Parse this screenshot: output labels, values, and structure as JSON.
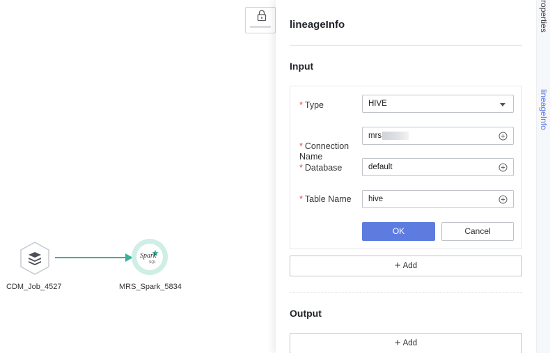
{
  "canvas": {
    "nodes": [
      {
        "label": "CDM_Job_4527",
        "icon": "cdm-stack-icon"
      },
      {
        "label": "MRS_Spark_5834",
        "icon": "spark-sql-icon",
        "icon_text": "Spark",
        "icon_subtext": "SQL"
      }
    ],
    "lock_button": {
      "icon": "lock-icon"
    },
    "edge_color": "#3bb09a"
  },
  "panel": {
    "title": "lineageInfo",
    "input": {
      "title": "Input",
      "fields": {
        "type": {
          "label": "Type",
          "value": "HIVE"
        },
        "connection": {
          "label": "Connection\nName",
          "value": "mrs"
        },
        "database": {
          "label": "Database",
          "value": "default"
        },
        "table_name": {
          "label": "Table Name",
          "value": "hive"
        }
      },
      "ok_label": "OK",
      "cancel_label": "Cancel",
      "add_label": "Add"
    },
    "output": {
      "title": "Output",
      "add_label": "Add"
    }
  },
  "side_tabs": {
    "node_properties": "Node Properties",
    "lineage_info": "lineageInfo"
  },
  "colors": {
    "accent": "#5e7ce0",
    "required": "#e64545",
    "edge": "#3bb09a"
  }
}
